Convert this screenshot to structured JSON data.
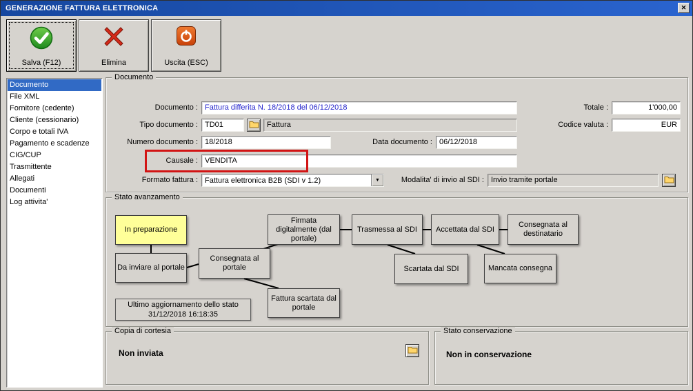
{
  "window": {
    "title": "GENERAZIONE FATTURA ELETTRONICA"
  },
  "icons": {
    "close": "✕",
    "dropdown_arrow": "▼"
  },
  "toolbar": {
    "save": "Salva (F12)",
    "delete": "Elimina",
    "exit": "Uscita (ESC)"
  },
  "sidebar": {
    "items": [
      {
        "label": "Documento",
        "selected": true
      },
      {
        "label": "File XML"
      },
      {
        "label": "Fornitore (cedente)"
      },
      {
        "label": "Cliente (cessionario)"
      },
      {
        "label": "Corpo e totali IVA"
      },
      {
        "label": "Pagamento e scadenze"
      },
      {
        "label": "CIG/CUP"
      },
      {
        "label": "Trasmittente"
      },
      {
        "label": "Allegati"
      },
      {
        "label": "Documenti"
      },
      {
        "label": "Log attivita'"
      }
    ]
  },
  "documento": {
    "legend": "Documento",
    "documento_label": "Documento :",
    "documento_value": "Fattura differita N. 18/2018 del 06/12/2018",
    "tipo_label": "Tipo documento :",
    "tipo_code": "TD01",
    "tipo_desc": "Fattura",
    "numero_label": "Numero documento :",
    "numero_value": "18/2018",
    "data_label": "Data documento :",
    "data_value": "06/12/2018",
    "causale_label": "Causale :",
    "causale_value": "VENDITA",
    "formato_label": "Formato fattura :",
    "formato_value": "Fattura elettronica B2B (SDI v 1.2)",
    "modalita_label": "Modalita' di invio al SDI :",
    "modalita_value": "Invio tramite portale",
    "totale_label": "Totale :",
    "totale_value": "1'000,00",
    "valuta_label": "Codice valuta :",
    "valuta_value": "EUR"
  },
  "flow": {
    "legend": "Stato avanzamento",
    "nodes": [
      {
        "label": "In preparazione",
        "state": "active"
      },
      {
        "label": "Da inviare al portale"
      },
      {
        "label": "Consegnata al portale"
      },
      {
        "label": "Firmata digitalmente (dal portale)"
      },
      {
        "label": "Trasmessa al SDI"
      },
      {
        "label": "Accettata dal SDI"
      },
      {
        "label": "Consegnata al destinatario"
      },
      {
        "label": "Scartata dal SDI"
      },
      {
        "label": "Mancata consegna"
      },
      {
        "label": "Fattura scartata dal portale"
      }
    ],
    "last_update_line1": "Ultimo aggiornamento dello stato",
    "last_update_line2": "31/12/2018 16:18:35"
  },
  "copia_cortesia": {
    "legend": "Copia di cortesia",
    "value": "Non inviata"
  },
  "stato_conservazione": {
    "legend": "Stato conservazione",
    "value": "Non in conservazione"
  },
  "annotations": {
    "causale_highlight_color": "#d21414"
  },
  "colors": {
    "title_blue": "#1e56c3",
    "highlight": "#316ac5",
    "active_node": "#ffff99"
  }
}
